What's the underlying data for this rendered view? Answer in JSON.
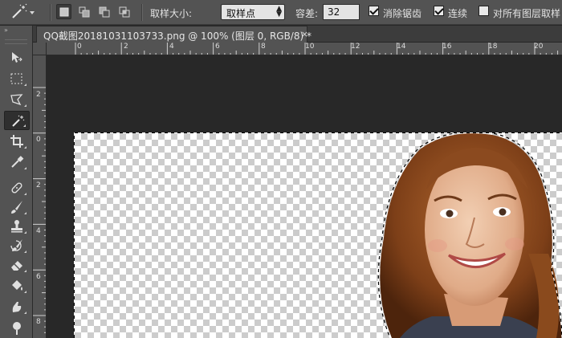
{
  "options_bar": {
    "sample_size_label": "取样大小:",
    "sample_size_value": "取样点",
    "tolerance_label": "容差:",
    "tolerance_value": "32",
    "anti_alias_label": "消除锯齿",
    "anti_alias_checked": true,
    "contiguous_label": "连续",
    "contiguous_checked": true,
    "sample_all_layers_label": "对所有图层取样",
    "sample_all_layers_checked": false
  },
  "toolbar": {
    "collapse_glyph": "»",
    "tools": [
      "move-tool",
      "marquee-tool",
      "lasso-tool",
      "magic-wand-tool",
      "crop-tool",
      "eyedropper-tool",
      "healing-brush-tool",
      "brush-tool",
      "clone-stamp-tool",
      "history-brush-tool",
      "eraser-tool",
      "paint-bucket-tool",
      "blur-tool",
      "dodge-tool"
    ],
    "active_tool": "magic-wand-tool"
  },
  "document": {
    "tab_title": "QQ截图20181031103733.png @ 100% (图层 0, RGB/8) *",
    "close_glyph": "×"
  },
  "rulers": {
    "horizontal": [
      "0",
      "2",
      "4",
      "6",
      "8",
      "10",
      "12",
      "14",
      "16",
      "18",
      "20"
    ],
    "vertical": [
      "2",
      "0",
      "2",
      "4",
      "6",
      "8"
    ]
  }
}
